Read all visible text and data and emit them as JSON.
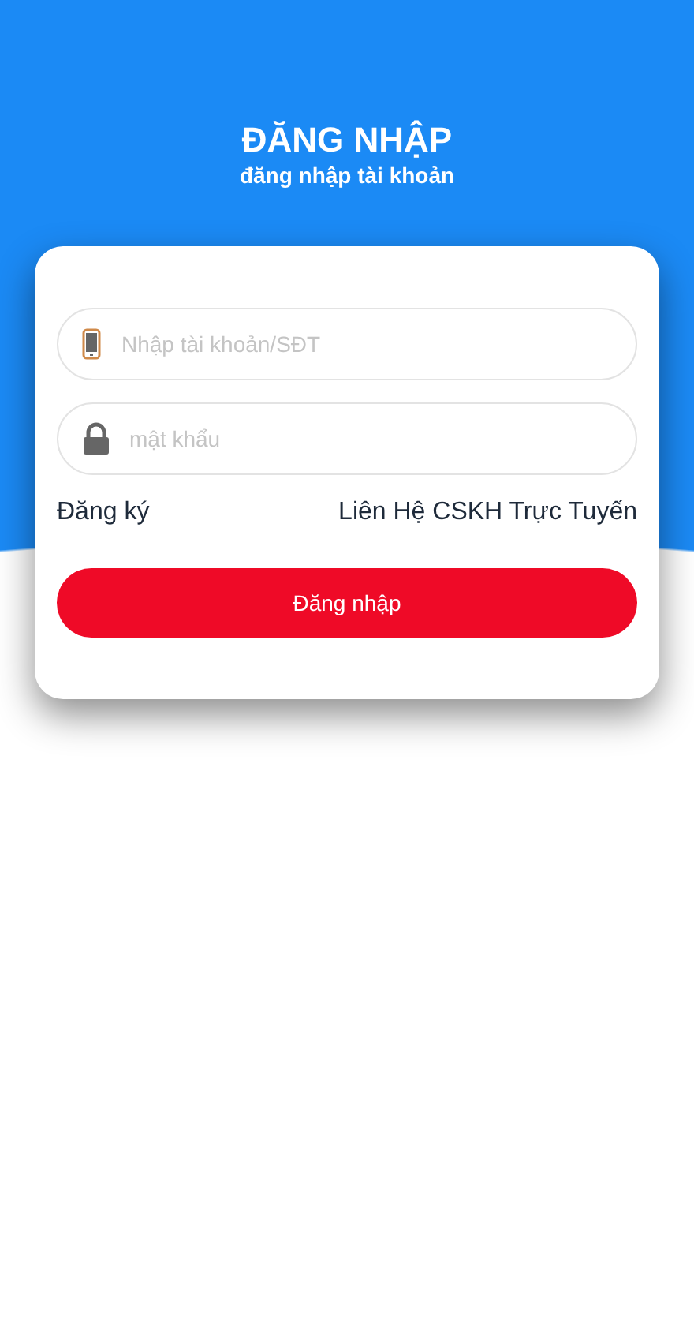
{
  "header": {
    "title": "ĐĂNG NHẬP",
    "subtitle": "đăng nhập tài khoản"
  },
  "fields": [
    {
      "kind": "phone",
      "placeholder": "Nhập tài khoản/SĐT"
    },
    {
      "kind": "lock",
      "placeholder": "mật khẩu"
    }
  ],
  "links": {
    "register": "Đăng ký",
    "support": "Liên Hệ CSKH Trực Tuyến"
  },
  "button": "Đăng nhập"
}
